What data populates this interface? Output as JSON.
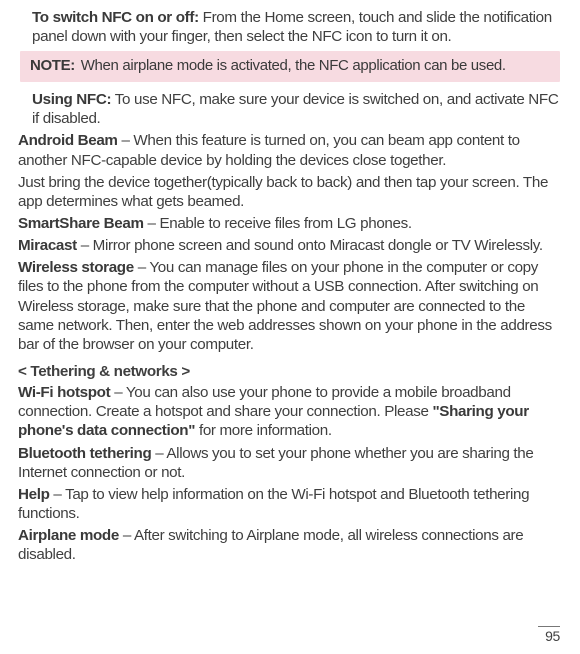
{
  "block1": {
    "switch_b": "To switch NFC on or off:",
    "switch_txt": " From the Home screen, touch and slide the notification panel down with your finger, then select the NFC icon to turn it on."
  },
  "note": {
    "label": "NOTE:",
    "text": " When airplane mode is activated, the NFC application can be used."
  },
  "using": {
    "b": "Using NFC:",
    "txt": " To use NFC, make sure your device is switched on, and activate NFC if disabled."
  },
  "ab": {
    "b": "Android Beam",
    "txt": " – When this feature is turned on, you can beam app content to another NFC-capable device by holding the devices close together."
  },
  "ab2": "Just bring the device together(typically back to back) and then tap your screen. The app determines what gets beamed.",
  "ssb": {
    "b": "SmartShare Beam",
    "txt": " – Enable to receive files from LG phones."
  },
  "mc": {
    "b": "Miracast",
    "txt": " – Mirror phone screen and sound onto Miracast dongle or TV Wirelessly."
  },
  "ws": {
    "b": "Wireless storage",
    "txt": " – You can manage files on your phone in the computer or copy files to the phone from the computer without a USB connection. After switching on Wireless storage, make sure that the phone and computer are connected to the same network. Then, enter the web addresses shown on your phone in the address bar of the browser on your computer."
  },
  "tetherhead": "< Tethering & networks >",
  "wh": {
    "b": "Wi-Fi hotspot",
    "txt1": " – You can also use your phone to provide a mobile broadband connection. Create a hotspot and share your connection. Please ",
    "quote": "\"Sharing your phone's data connection\"",
    "txt2": " for more information."
  },
  "bt": {
    "b": "Bluetooth tethering",
    "txt": " – Allows you to set your phone whether you are sharing the Internet connection or not."
  },
  "help": {
    "b": "Help",
    "txt": " – Tap to view help information on the Wi-Fi hotspot and Bluetooth tethering functions."
  },
  "am": {
    "b": "Airplane mode",
    "txt": " – After switching to Airplane mode, all wireless connections are disabled."
  },
  "page_number": "95"
}
